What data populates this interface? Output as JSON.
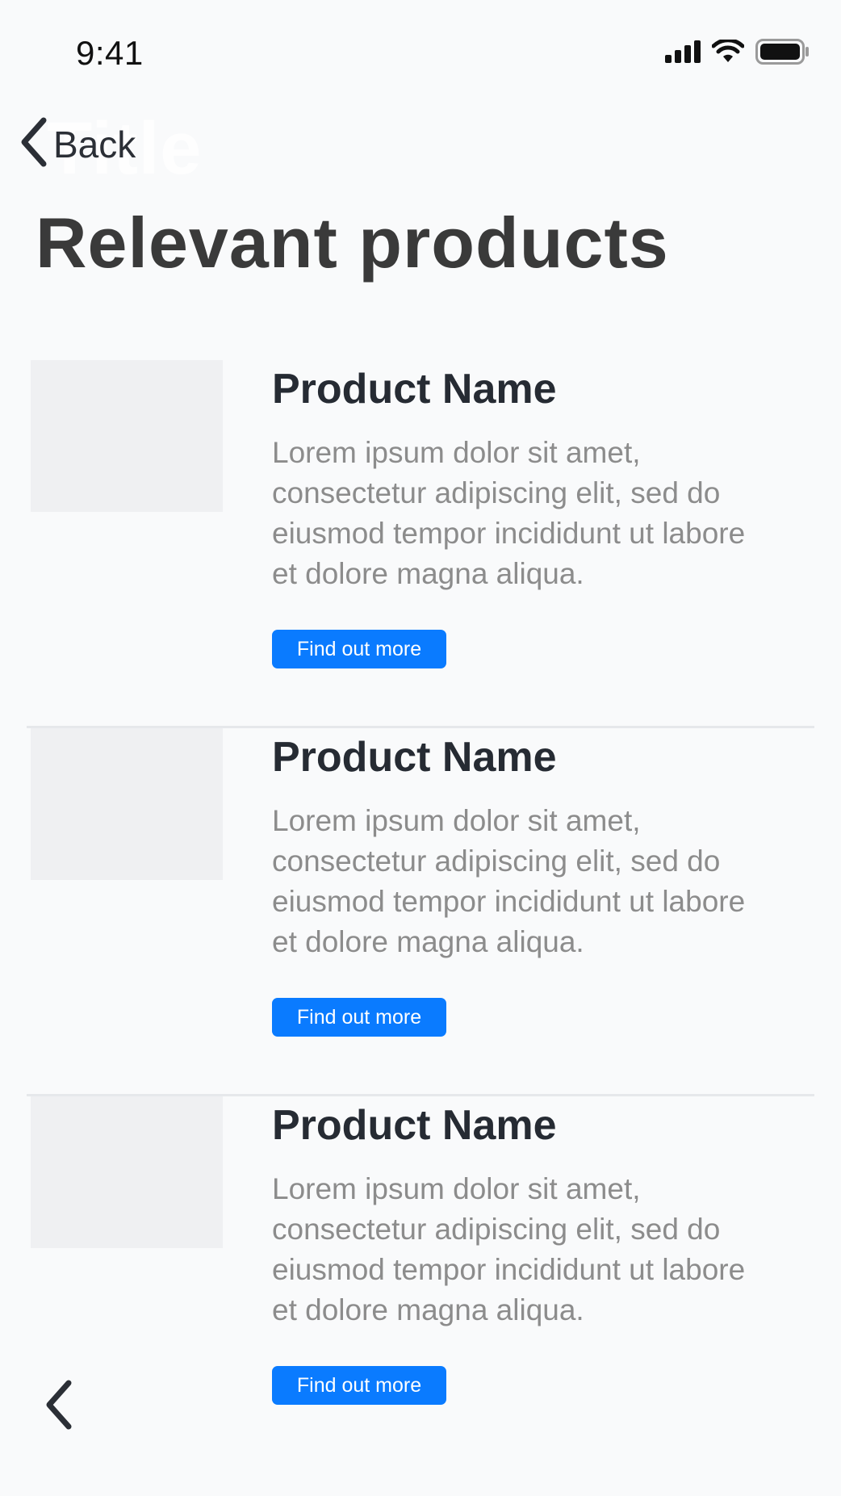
{
  "status_bar": {
    "time": "9:41"
  },
  "nav": {
    "back_label": "Back",
    "ghost_title": "Title"
  },
  "page": {
    "title": "Relevant products"
  },
  "products": [
    {
      "name": "Product Name",
      "description": "Lorem ipsum dolor sit amet, consectetur adipiscing elit, sed do eiusmod tempor incididunt ut labore et dolore magna aliqua.",
      "button_label": "Find out more"
    },
    {
      "name": "Product Name",
      "description": "Lorem ipsum dolor sit amet, consectetur adipiscing elit, sed do eiusmod tempor incididunt ut labore et dolore magna aliqua.",
      "button_label": "Find out more"
    },
    {
      "name": "Product Name",
      "description": "Lorem ipsum dolor sit amet, consectetur adipiscing elit, sed do eiusmod tempor incididunt ut labore et dolore magna aliqua.",
      "button_label": "Find out more"
    }
  ],
  "icons": {
    "signal": "cellular-signal-icon",
    "wifi": "wifi-icon",
    "battery": "battery-icon",
    "back": "chevron-left-icon",
    "bottom_nav": "chevron-left-icon"
  },
  "colors": {
    "background": "#F9FAFB",
    "accent": "#0A7BFF",
    "title": "#3A3A3A",
    "product_name": "#262B33",
    "body_text": "#8C8C8C",
    "thumbnail": "#EFF0F2"
  }
}
